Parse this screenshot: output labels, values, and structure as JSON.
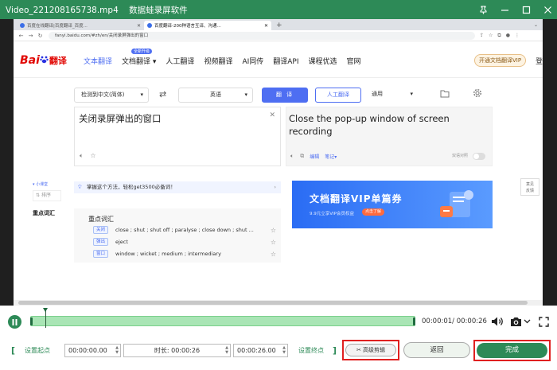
{
  "app": {
    "file_name": "Video_221208165738.mp4",
    "software_name": "数据蛙录屏软件"
  },
  "browser": {
    "tabs": [
      {
        "label": "百度在线翻译|百度翻译_百度...",
        "active": false
      },
      {
        "label": "百度翻译-200种语言互译、沟通...",
        "active": true
      }
    ],
    "new_tab": "+",
    "url": "fanyi.baidu.com/#zh/en/关闭录屏弹出的窗口"
  },
  "baidu": {
    "logo_bai": "Bai",
    "logo_du": "du",
    "logo_fy": "翻译",
    "nav": [
      "文本翻译",
      "文档翻译",
      "人工翻译",
      "视频翻译",
      "AI同传",
      "翻译API",
      "课程优选",
      "官网"
    ],
    "hot_badge": "全新升级",
    "vip_button": "开通文档翻译VIP",
    "login": "登"
  },
  "translate": {
    "src_lang": "检测到中文(简体)",
    "tgt_lang": "英语",
    "translate_btn": "翻 译",
    "human_btn": "人工翻译",
    "domain_select": "通用",
    "source_text": "关闭录屏弹出的窗口",
    "target_text": "Close the pop-up window of screen recording",
    "edit_label": "编辑",
    "notes_label": "笔记",
    "dual_label": "双语对照"
  },
  "side": {
    "small_label": "小课堂",
    "sort_label": "排序",
    "key_words_label": "重点词汇"
  },
  "tip": {
    "text": "掌握这个方法，轻松get3500必备词！"
  },
  "banner": {
    "title": "文档翻译VIP单篇券",
    "subtitle": "9.9元立享VIP会员权益",
    "cta": "点击了解"
  },
  "feedback": {
    "line1": "意见",
    "line2": "反馈"
  },
  "keywords": {
    "title": "重点词汇",
    "rows": [
      {
        "tag": "关闭",
        "def": "close ; shut ; shut off ; paralyse ; close down ; shut ..."
      },
      {
        "tag": "弹出",
        "def": "eject"
      },
      {
        "tag": "窗口",
        "def": "window ; wicket ; medium ; intermediary"
      }
    ]
  },
  "player": {
    "time_display": "00:00:01/ 00:00:26",
    "progress_fraction": 0.04,
    "set_start": "设置起点",
    "start_time": "00:00:00.00",
    "duration_label": "时长:",
    "duration": "00:00:26",
    "end_time": "00:00:26.00",
    "set_end": "设置终点",
    "advanced_edit": "高级剪辑",
    "back": "返回",
    "done": "完成"
  },
  "colors": {
    "accent_green": "#2d8a57",
    "baidu_blue": "#4e6ef2",
    "highlight_red": "#e02020"
  }
}
